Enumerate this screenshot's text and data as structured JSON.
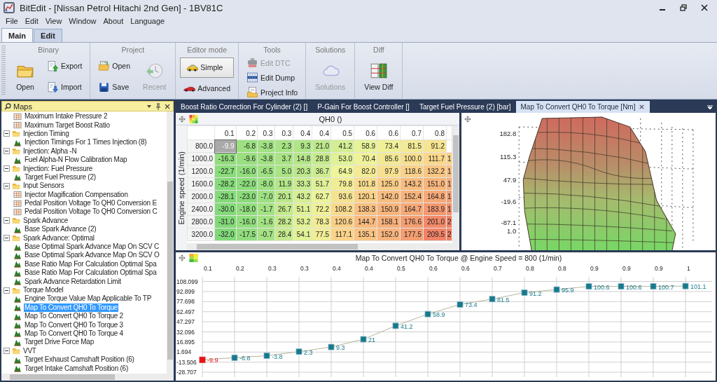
{
  "window": {
    "title": "BitEdit - [Nissan Petrol Hitachi 2nd Gen] - 1BV81C"
  },
  "menu": [
    "File",
    "Edit",
    "View",
    "Window",
    "About",
    "Language"
  ],
  "ribbon": {
    "tabs": [
      {
        "label": "Main",
        "selected": true
      },
      {
        "label": "Edit",
        "selected": false
      }
    ],
    "groups": [
      {
        "title": "Binary",
        "buttons": [
          {
            "label": "Open",
            "kind": "large",
            "disabled": false
          },
          {
            "label": "Export",
            "kind": "small",
            "disabled": false
          },
          {
            "label": "Import",
            "kind": "small",
            "disabled": false
          }
        ]
      },
      {
        "title": "Project",
        "buttons": [
          {
            "label": "Open",
            "kind": "small",
            "disabled": false
          },
          {
            "label": "Save",
            "kind": "small",
            "disabled": false
          },
          {
            "label": "Recent",
            "kind": "large",
            "disabled": true
          }
        ]
      },
      {
        "title": "Editor mode",
        "buttons": [
          {
            "label": "Simple",
            "kind": "small",
            "disabled": false,
            "selected": true
          },
          {
            "label": "Advanced",
            "kind": "small",
            "disabled": false,
            "selected": false
          }
        ]
      },
      {
        "title": "Tools",
        "buttons": [
          {
            "label": "Edit DTC",
            "kind": "small",
            "disabled": true
          },
          {
            "label": "Edit Dump",
            "kind": "small",
            "disabled": false
          },
          {
            "label": "Project Info",
            "kind": "small",
            "disabled": false
          }
        ]
      },
      {
        "title": "Solutions",
        "buttons": [
          {
            "label": "Solutions",
            "kind": "large",
            "disabled": true
          }
        ]
      },
      {
        "title": "Diff",
        "buttons": [
          {
            "label": "View Diff",
            "kind": "large",
            "disabled": false
          }
        ]
      }
    ]
  },
  "maps_panel": {
    "title": "Maps",
    "tree": [
      {
        "children": [
          {
            "label": "Maximum Intake Pressure 2",
            "kind": "table",
            "selected": false
          },
          {
            "label": "Maximum Target Boost Ratio",
            "kind": "table",
            "selected": false
          }
        ]
      },
      {
        "label": "Injection Timing",
        "expanded": true,
        "children": [
          {
            "label": "Injection Timings For 1 Times Injection (8)",
            "kind": "surface",
            "selected": false
          }
        ]
      },
      {
        "label": "Injection: Alpha -N",
        "expanded": true,
        "children": [
          {
            "label": "Fuel Alpha-N Flow Calibration Map",
            "kind": "surface",
            "selected": false
          }
        ]
      },
      {
        "label": "Injection: Fuel Pressure",
        "expanded": true,
        "children": [
          {
            "label": "Target Fuel Pressure (2)",
            "kind": "surface",
            "selected": false
          }
        ]
      },
      {
        "label": "Input Sensors",
        "expanded": true,
        "children": [
          {
            "label": "Injector Magification Compensation",
            "kind": "table",
            "selected": false
          },
          {
            "label": "Pedal Position Voltage To QH0 Conversion E",
            "kind": "table",
            "selected": false
          },
          {
            "label": "Pedal Position Voltage To QH0 Conversion C",
            "kind": "table",
            "selected": false
          }
        ]
      },
      {
        "label": "Spark Advance",
        "expanded": true,
        "children": [
          {
            "label": "Base Spark Advance (2)",
            "kind": "surface",
            "selected": false
          }
        ]
      },
      {
        "label": "Spark Advance: Optimal",
        "expanded": true,
        "children": [
          {
            "label": "Base Optimal Spark Advance Map On SCV C",
            "kind": "surface",
            "selected": false
          },
          {
            "label": "Base Optimal Spark Advance Map On SCV O",
            "kind": "surface",
            "selected": false
          },
          {
            "label": "Base Ratio Map For Calculation Optimal Spa",
            "kind": "surface",
            "selected": false
          },
          {
            "label": "Base Ratio Map For Calculation Optimal Spa",
            "kind": "surface",
            "selected": false
          },
          {
            "label": "Spark Advance Retardation Limit",
            "kind": "surface",
            "selected": false
          }
        ]
      },
      {
        "label": "Torque Model",
        "expanded": true,
        "children": [
          {
            "label": "Engine Torque Value Map Applicable To TP",
            "kind": "surface",
            "selected": false
          },
          {
            "label": "Map To Convert QH0 To Torque",
            "kind": "surface",
            "selected": true
          },
          {
            "label": "Map To Convert QH0 To Torque 2",
            "kind": "surface",
            "selected": false
          },
          {
            "label": "Map To Convert QH0 To Torque 3",
            "kind": "surface",
            "selected": false
          },
          {
            "label": "Map To Convert QH0 To Torque 4",
            "kind": "surface",
            "selected": false
          },
          {
            "label": "Target Drive Force Map",
            "kind": "surface",
            "selected": false
          }
        ]
      },
      {
        "label": "VVT",
        "expanded": true,
        "children": [
          {
            "label": "Target Exhaust Camshaft Position (6)",
            "kind": "surface",
            "selected": false
          },
          {
            "label": "Target Intake Camshaft Position (6)",
            "kind": "surface",
            "selected": false
          }
        ]
      }
    ]
  },
  "documents": {
    "tabs": [
      {
        "label": "Boost Ratio Correction For Cylinder (2) []",
        "selected": false
      },
      {
        "label": "P-Gain For Boost Controller []",
        "selected": false
      },
      {
        "label": "Target Fuel Pressure (2) [bar]",
        "selected": false
      },
      {
        "label": "Map To Convert QH0 To Torque [Nm]",
        "selected": true
      }
    ]
  },
  "table": {
    "x_title": "QH0 ()",
    "y_title": "Engine speed (1/min)",
    "columns": [
      "0.1",
      "0.2",
      "0.3",
      "0.3",
      "0.4",
      "0.4",
      "0.5",
      "0.6",
      "0.6",
      "0.7",
      "0.8"
    ],
    "rows": [
      {
        "label": "800.0",
        "cells": [
          {
            "value": "-9.9",
            "selected": true
          },
          {
            "value": "-6.8",
            "selected": false
          },
          {
            "value": "-3.8",
            "selected": false
          },
          {
            "value": "2.3",
            "selected": false
          },
          {
            "value": "9.3",
            "selected": false
          },
          {
            "value": "21.0",
            "selected": false
          },
          {
            "value": "41.2",
            "selected": false
          },
          {
            "value": "58.9",
            "selected": false
          },
          {
            "value": "73.4",
            "selected": false
          },
          {
            "value": "81.5",
            "selected": false
          },
          {
            "value": "91.2",
            "selected": false
          }
        ]
      },
      {
        "label": "1000.0",
        "overflow": "1",
        "cells": [
          {
            "value": "-16.3",
            "selected": false
          },
          {
            "value": "-9.6",
            "selected": false
          },
          {
            "value": "-3.8",
            "selected": false
          },
          {
            "value": "3.7",
            "selected": false
          },
          {
            "value": "14.8",
            "selected": false
          },
          {
            "value": "28.8",
            "selected": false
          },
          {
            "value": "53.0",
            "selected": false
          },
          {
            "value": "70.4",
            "selected": false
          },
          {
            "value": "85.6",
            "selected": false
          },
          {
            "value": "100.0",
            "selected": false
          },
          {
            "value": "111.7",
            "selected": false
          }
        ]
      },
      {
        "label": "1200.0",
        "overflow": "1",
        "cells": [
          {
            "value": "-22.7",
            "selected": false
          },
          {
            "value": "-16.0",
            "selected": false
          },
          {
            "value": "-6.5",
            "selected": false
          },
          {
            "value": "5.0",
            "selected": false
          },
          {
            "value": "20.3",
            "selected": false
          },
          {
            "value": "36.7",
            "selected": false
          },
          {
            "value": "64.9",
            "selected": false
          },
          {
            "value": "82.0",
            "selected": false
          },
          {
            "value": "97.9",
            "selected": false
          },
          {
            "value": "118.6",
            "selected": false
          },
          {
            "value": "132.2",
            "selected": false
          }
        ]
      },
      {
        "label": "1600.0",
        "overflow": "1",
        "cells": [
          {
            "value": "-28.2",
            "selected": false
          },
          {
            "value": "-22.0",
            "selected": false
          },
          {
            "value": "-8.0",
            "selected": false
          },
          {
            "value": "11.9",
            "selected": false
          },
          {
            "value": "33.3",
            "selected": false
          },
          {
            "value": "51.7",
            "selected": false
          },
          {
            "value": "79.8",
            "selected": false
          },
          {
            "value": "101.8",
            "selected": false
          },
          {
            "value": "125.0",
            "selected": false
          },
          {
            "value": "143.2",
            "selected": false
          },
          {
            "value": "151.0",
            "selected": false
          }
        ]
      },
      {
        "label": "2000.0",
        "overflow": "1",
        "cells": [
          {
            "value": "-28.1",
            "selected": false
          },
          {
            "value": "-23.0",
            "selected": false
          },
          {
            "value": "-7.0",
            "selected": false
          },
          {
            "value": "20.1",
            "selected": false
          },
          {
            "value": "43.2",
            "selected": false
          },
          {
            "value": "62.7",
            "selected": false
          },
          {
            "value": "93.6",
            "selected": false
          },
          {
            "value": "120.1",
            "selected": false
          },
          {
            "value": "142.0",
            "selected": false
          },
          {
            "value": "152.4",
            "selected": false
          },
          {
            "value": "164.8",
            "selected": false
          }
        ]
      },
      {
        "label": "2400.0",
        "overflow": "1",
        "cells": [
          {
            "value": "-30.0",
            "selected": false
          },
          {
            "value": "-18.0",
            "selected": false
          },
          {
            "value": "-1.7",
            "selected": false
          },
          {
            "value": "26.7",
            "selected": false
          },
          {
            "value": "51.1",
            "selected": false
          },
          {
            "value": "72.2",
            "selected": false
          },
          {
            "value": "108.2",
            "selected": false
          },
          {
            "value": "138.3",
            "selected": false
          },
          {
            "value": "150.9",
            "selected": false
          },
          {
            "value": "164.7",
            "selected": false
          },
          {
            "value": "183.9",
            "selected": false
          }
        ]
      },
      {
        "label": "2800.0",
        "overflow": "2",
        "cells": [
          {
            "value": "-31.0",
            "selected": false
          },
          {
            "value": "-16.0",
            "selected": false
          },
          {
            "value": "-1.6",
            "selected": false
          },
          {
            "value": "28.2",
            "selected": false
          },
          {
            "value": "53.2",
            "selected": false
          },
          {
            "value": "78.3",
            "selected": false
          },
          {
            "value": "120.6",
            "selected": false
          },
          {
            "value": "144.7",
            "selected": false
          },
          {
            "value": "158.1",
            "selected": false
          },
          {
            "value": "176.6",
            "selected": false
          },
          {
            "value": "201.0",
            "selected": false
          }
        ]
      },
      {
        "label": "3200.0",
        "overflow": "2",
        "cells": [
          {
            "value": "-32.0",
            "selected": false
          },
          {
            "value": "-17.5",
            "selected": false
          },
          {
            "value": "-0.7",
            "selected": false
          },
          {
            "value": "28.4",
            "selected": false
          },
          {
            "value": "54.1",
            "selected": false
          },
          {
            "value": "77.5",
            "selected": false
          },
          {
            "value": "117.1",
            "selected": false
          },
          {
            "value": "135.1",
            "selected": false
          },
          {
            "value": "152.0",
            "selected": false
          },
          {
            "value": "177.5",
            "selected": false
          },
          {
            "value": "209.5",
            "selected": false
          }
        ]
      }
    ]
  },
  "surface_view": {
    "z_ticks": [
      "182.8",
      "115.3",
      "47.9",
      "-19.6",
      "-87.1",
      "1.0"
    ]
  },
  "line_chart": {
    "title": "Map To Convert QH0 To Torque @ Engine Speed = 800 (1/min)",
    "chart_data": {
      "type": "line",
      "categories": [
        "0.1",
        "0.2",
        "0.3",
        "0.3",
        "0.4",
        "0.4",
        "0.5",
        "0.6",
        "0.6",
        "0.7",
        "0.8",
        "0.8",
        "0.9",
        "0.9",
        "0.9",
        "1"
      ],
      "series": [
        {
          "color": "#17798b",
          "marker": "square",
          "values": [
            -9.9,
            -6.8,
            -3.8,
            2.3,
            9.3,
            21,
            41.2,
            58.9,
            73.4,
            81.5,
            91.2,
            95.9,
            100.6,
            100.6,
            100.7,
            101.1
          ]
        }
      ],
      "ylim": [
        -36,
        115
      ],
      "yticks": [
        108.099,
        92.899,
        77.698,
        62.497,
        47.297,
        32.096,
        16.895,
        1.694,
        -13.506,
        -28.707
      ],
      "grid": true,
      "data_labels": true
    },
    "point_selected": [
      true,
      false,
      false,
      false,
      false,
      false,
      false,
      false,
      false,
      false,
      false,
      false,
      false,
      false,
      false,
      false
    ]
  }
}
